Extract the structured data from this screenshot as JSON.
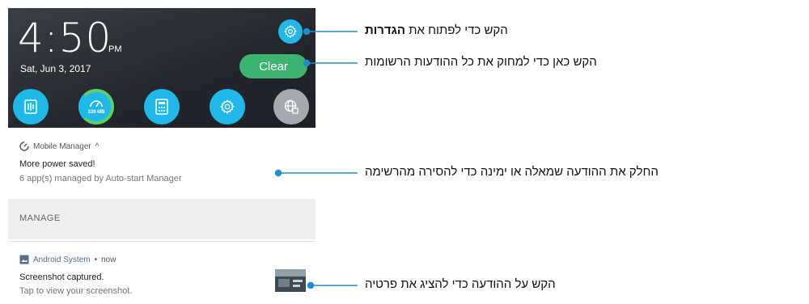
{
  "shade": {
    "time": "4:50",
    "ampm": "PM",
    "date": "Sat, Jun 3, 2017",
    "clear_label": "Clear",
    "settings_icon": "gear-icon",
    "quick_settings": [
      {
        "icon": "sound-equalizer-icon"
      },
      {
        "icon": "boost-gauge-icon",
        "text": "339 MB"
      },
      {
        "icon": "calculator-icon"
      },
      {
        "icon": "gear-icon"
      },
      {
        "icon": "globe-network-icon"
      }
    ]
  },
  "notifications": [
    {
      "app": "Mobile Manager",
      "app_suffix": "^",
      "title": "More power saved!",
      "body": "6 app(s) managed by Auto-start Manager",
      "action": "MANAGE"
    },
    {
      "app": "Android System",
      "time": "now",
      "title": "Screenshot captured.",
      "body": "Tap to view your screenshot."
    }
  ],
  "callouts": {
    "settings_prefix": "הקש כדי לפתוח את",
    "settings_bold": "הגדרות",
    "clear": "הקש כאן כדי למחוק את כל ההודעות הרשומות",
    "swipe": "החלק את ההודעה שמאלה או ימינה כדי להסירה מהרשימה",
    "tap": "הקש על ההודעה כדי להציג את פרטיה"
  },
  "colors": {
    "accent": "#1fb8e8",
    "clear_green": "#3cb371",
    "boost_ring": "#5ccf6a",
    "line": "#1c8fd0"
  }
}
